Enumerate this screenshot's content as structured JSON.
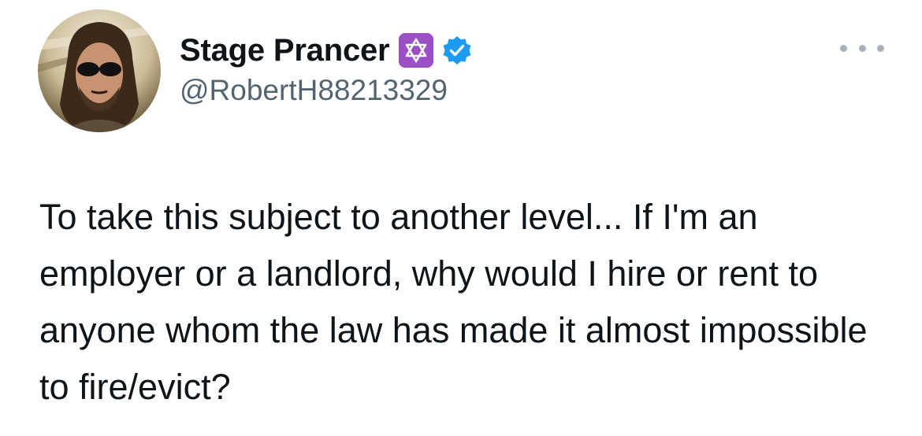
{
  "tweet": {
    "author": {
      "display_name": "Stage Prancer",
      "handle": "@RobertH88213329",
      "badge_emoji_icon": "star-of-david-icon",
      "verified_icon": "verified-badge-icon",
      "verified_color": "#1d9bf0",
      "badge_color": "#9b4fc4"
    },
    "text": "To take this subject to another level...  If I'm an employer or a landlord, why would I hire or rent to anyone whom the law has made it almost impossible to fire/evict?"
  }
}
